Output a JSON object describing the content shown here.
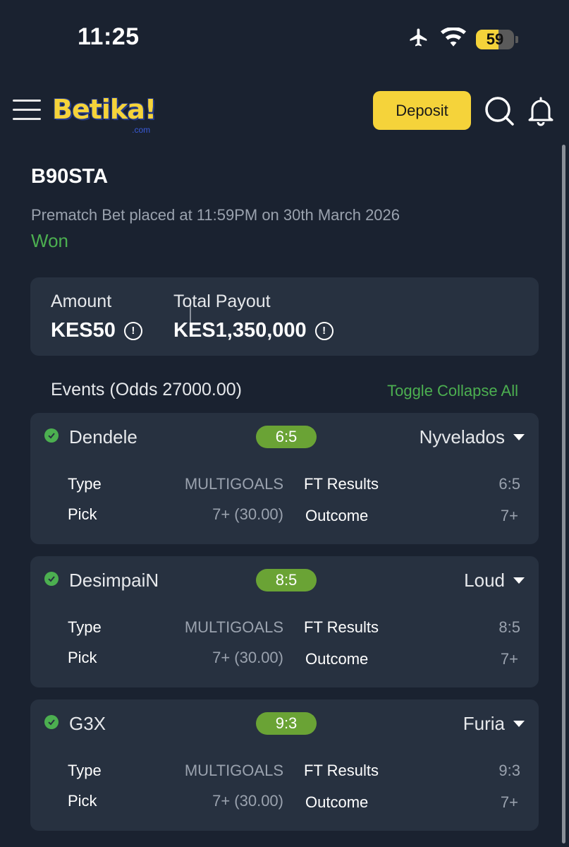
{
  "status_bar": {
    "time": "11:25",
    "battery": "59",
    "battery_level": 0.59,
    "icons": [
      "airplane-icon",
      "wifi-icon",
      "battery-icon"
    ]
  },
  "header": {
    "logo_text": "Betika!",
    "logo_sub": ".com",
    "deposit_label": "Deposit",
    "icons": [
      "menu-icon",
      "search-icon",
      "bell-icon"
    ]
  },
  "bet": {
    "code": "B90STA",
    "placed": "Prematch Bet placed at 11:59PM on 30th March 2026",
    "status": "Won"
  },
  "amount": {
    "amount_label": "Amount",
    "amount_value": "KES50",
    "payout_label": "Total Payout",
    "payout_value": "KES1,350,000",
    "info_glyph": "!"
  },
  "events": {
    "title": "Events (Odds 27000.00)",
    "toggle_label": "Toggle Collapse All",
    "items": [
      {
        "home": "Dendele",
        "score": "6:5",
        "away": "Nyvelados",
        "type_label": "Type",
        "type_value": "MULTIGOALS",
        "ft_label": "FT Results",
        "ft_value": "6:5",
        "pick_label": "Pick",
        "pick_value": "7+ (30.00)",
        "outcome_label": "Outcome",
        "outcome_value": "7+"
      },
      {
        "home": "DesimpaiN",
        "score": "8:5",
        "away": "Loud",
        "type_label": "Type",
        "type_value": "MULTIGOALS",
        "ft_label": "FT Results",
        "ft_value": "8:5",
        "pick_label": "Pick",
        "pick_value": "7+ (30.00)",
        "outcome_label": "Outcome",
        "outcome_value": "7+"
      },
      {
        "home": "G3X",
        "score": "9:3",
        "away": "Furia",
        "type_label": "Type",
        "type_value": "MULTIGOALS",
        "ft_label": "FT Results",
        "ft_value": "9:3",
        "pick_label": "Pick",
        "pick_value": "7+ (30.00)",
        "outcome_label": "Outcome",
        "outcome_value": "7+"
      }
    ]
  },
  "colors": {
    "background": "#1a2230",
    "card": "#273140",
    "accent_yellow": "#f5d33a",
    "won_green": "#4caf50",
    "score_pill": "#6aa335"
  }
}
